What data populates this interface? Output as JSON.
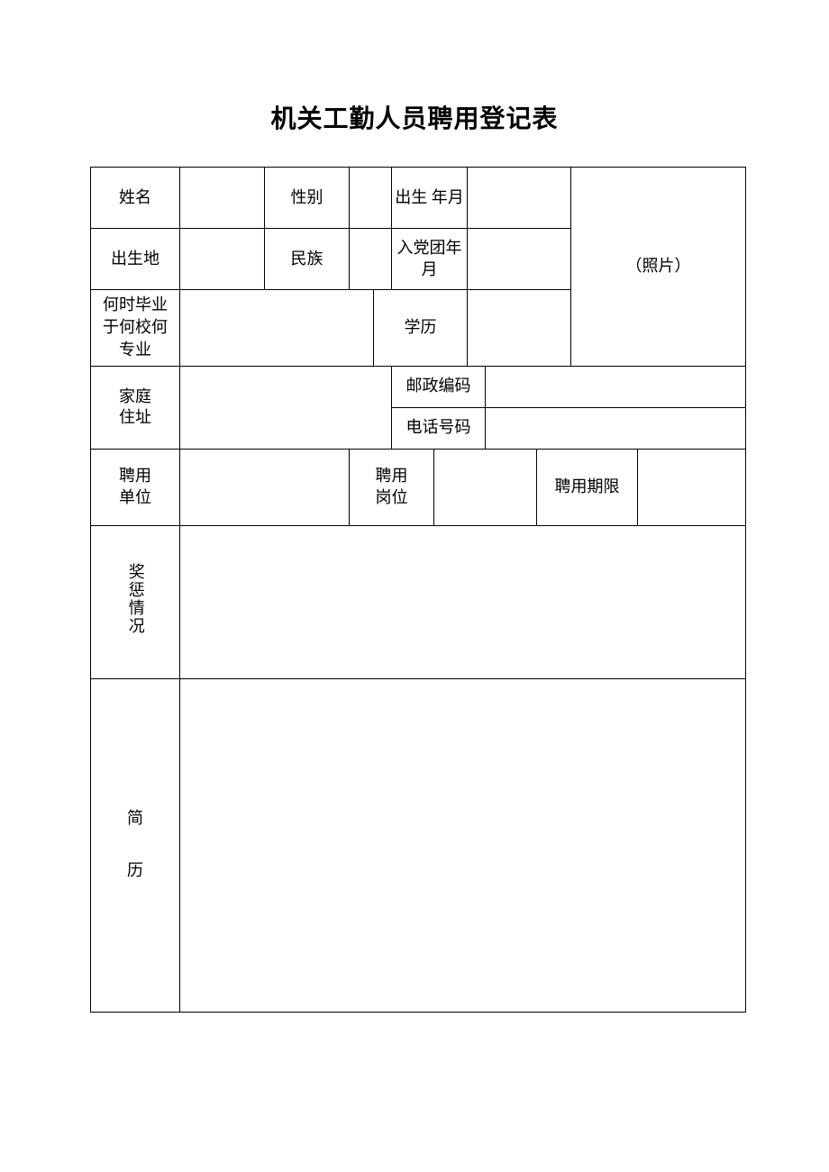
{
  "title": "机关工勤人员聘用登记表",
  "labels": {
    "name": "姓名",
    "gender": "性别",
    "birth": "出生\n年月",
    "birthplace": "出生地",
    "ethnicity": "民族",
    "party_date": "入党团年\n月",
    "photo": "（照片）",
    "graduation": "何时毕业\n于何校何\n专业",
    "education": "学历",
    "home_addr_l1": "家庭",
    "home_addr_l2": "住址",
    "postcode": "邮政编码",
    "phone": "电话号码",
    "employer_l1": "聘用",
    "employer_l2": "单位",
    "position_l1": "聘用",
    "position_l2": "岗位",
    "term": "聘用期限",
    "awards": "奖惩情况",
    "resume_l1": "简",
    "resume_l2": "历"
  },
  "values": {
    "name": "",
    "gender": "",
    "birth": "",
    "birthplace": "",
    "ethnicity": "",
    "party_date": "",
    "graduation": "",
    "education": "",
    "home_addr": "",
    "postcode": "",
    "phone": "",
    "employer": "",
    "position": "",
    "term": "",
    "awards": "",
    "resume": ""
  }
}
